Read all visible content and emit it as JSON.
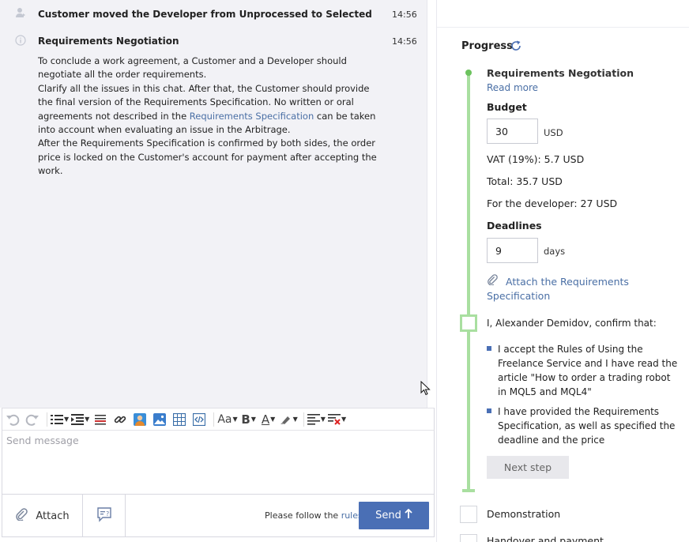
{
  "chat": {
    "messages": [
      {
        "icon": "user-move-icon",
        "title": "Customer moved the Developer from Unprocessed to Selected",
        "time": "14:56"
      },
      {
        "icon": "info-icon",
        "title": "Requirements Negotiation",
        "time": "14:56",
        "body": {
          "p1": "To conclude a work agreement, a Customer and a Developer should negotiate all the order requirements.",
          "p2_a": "Clarify all the issues in this chat. After that, the Customer should provide the final version of the Requirements Specification. No written or oral agreements not described in the ",
          "p2_link": "Requirements Specification",
          "p2_b": " can be taken into account when evaluating an issue in the Arbitrage.",
          "p3": "After the Requirements Specification is confirmed by both sides, the order price is locked on the Customer's account for payment after accepting the work."
        }
      }
    ],
    "toolbar": {
      "font_label": "Aa",
      "bold_label": "B",
      "color_label": "A"
    },
    "compose": {
      "placeholder": "Send message"
    },
    "attach_label": "Attach",
    "rules_prefix": "Please follow the ",
    "rules_link": "rules",
    "send_label": "Send"
  },
  "panel": {
    "progress_title": "Progress",
    "stage_title": "Requirements Negotiation",
    "read_more": "Read more",
    "budget_label": "Budget",
    "budget_value": "30",
    "budget_unit": "USD",
    "vat": "VAT (19%): 5.7 USD",
    "total": "Total: 35.7 USD",
    "developer": "For the developer: 27 USD",
    "deadlines_label": "Deadlines",
    "deadlines_value": "9",
    "deadlines_unit": "days",
    "attach_spec": "Attach the Requirements Specification",
    "confirm": "I, Alexander Demidov, confirm that:",
    "bullet1": "I accept the Rules of Using the Freelance Service and I have read the article \"How to order a trading robot in MQL5 and MQL4\"",
    "bullet2": "I have provided the Requirements Specification, as well as specified the deadline and the price",
    "next_step": "Next step",
    "demonstration": "Demonstration",
    "next_stage_partial": "Handover and payment"
  },
  "colors": {
    "accent": "#4a6fb5",
    "progress_line": "#a9dfa0",
    "link": "#4a6fa5"
  }
}
